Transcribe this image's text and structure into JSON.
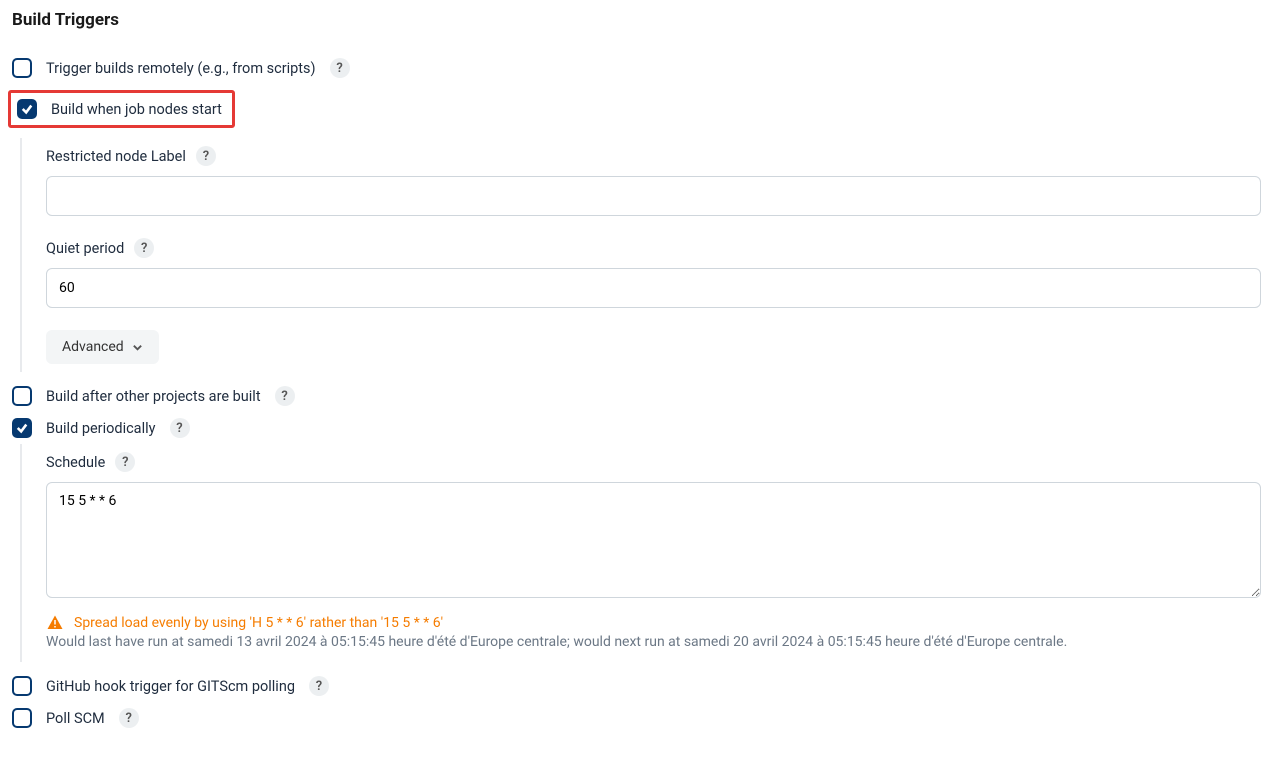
{
  "section_title": "Build Triggers",
  "triggers": {
    "remote": {
      "label": "Trigger builds remotely (e.g., from scripts)",
      "checked": false
    },
    "nodes_start": {
      "label": "Build when job nodes start",
      "checked": true,
      "restricted_label": "Restricted node Label",
      "restricted_value": "",
      "quiet_label": "Quiet period",
      "quiet_value": "60",
      "advanced": "Advanced"
    },
    "after_projects": {
      "label": "Build after other projects are built",
      "checked": false
    },
    "periodically": {
      "label": "Build periodically",
      "checked": true,
      "schedule_label": "Schedule",
      "schedule_value": "15 5 * * 6",
      "warn_text": "Spread load evenly by using 'H 5 * * 6' rather than '15 5 * * 6'",
      "info_text": "Would last have run at samedi 13 avril 2024 à 05:15:45 heure d'été d'Europe centrale; would next run at samedi 20 avril 2024 à 05:15:45 heure d'été d'Europe centrale."
    },
    "github_hook": {
      "label": "GitHub hook trigger for GITScm polling",
      "checked": false
    },
    "poll_scm": {
      "label": "Poll SCM",
      "checked": false
    }
  },
  "icons": {
    "help": "?"
  }
}
